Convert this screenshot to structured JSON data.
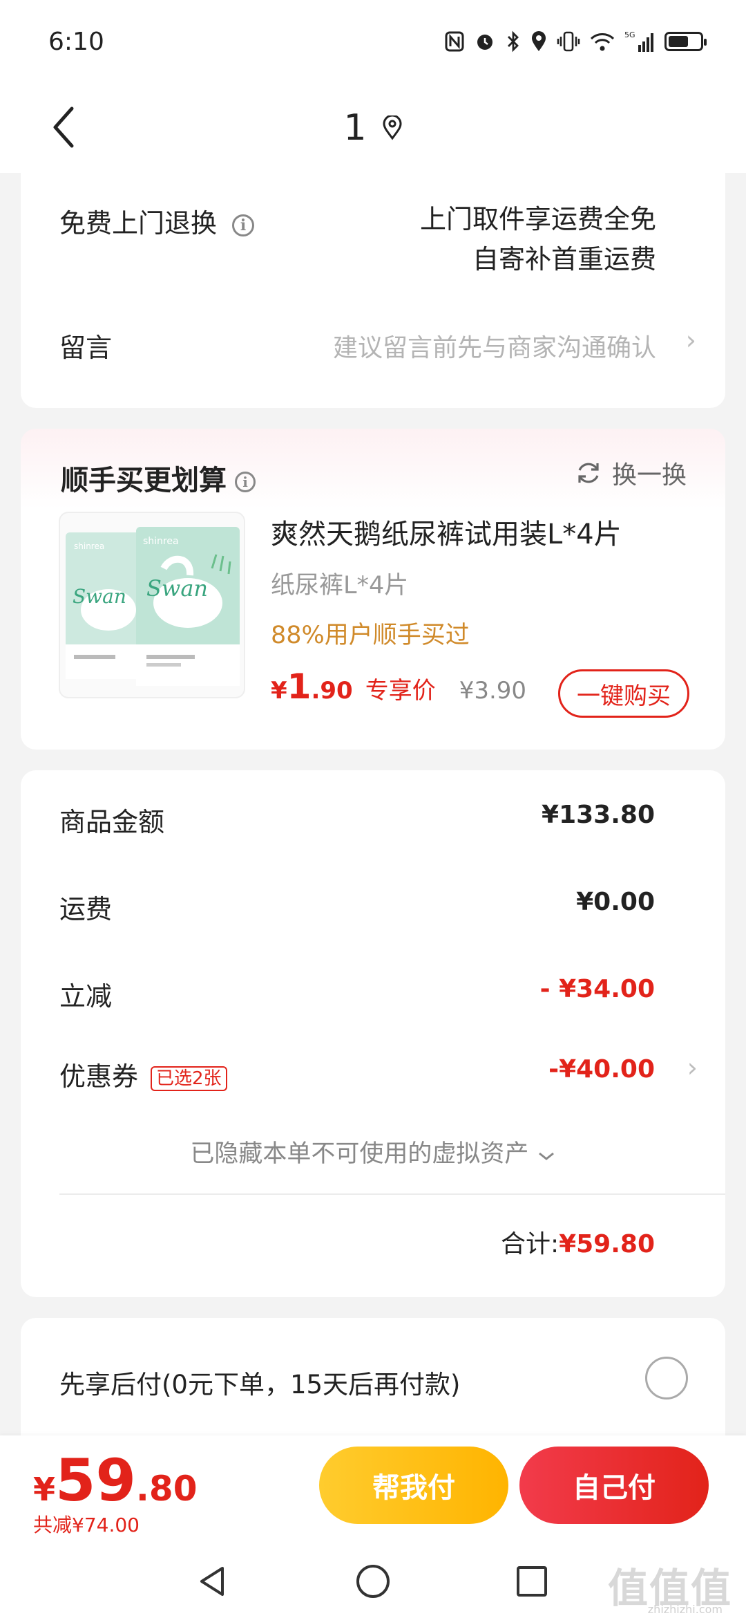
{
  "status_bar": {
    "time": "6:10",
    "network": "5G"
  },
  "nav": {
    "title": "1"
  },
  "return_service": {
    "label": "免费上门退换",
    "line1": "上门取件享运费全免",
    "line2": "自寄补首重运费"
  },
  "message": {
    "label": "留言",
    "placeholder": "建议留言前先与商家沟通确认"
  },
  "upsell": {
    "title": "顺手买更划算",
    "refresh_label": "换一换",
    "product": {
      "name": "爽然天鹅纸尿裤试用装L*4片",
      "spec": "纸尿裤L*4片",
      "social_proof": "88%用户顺手买过",
      "price_symbol": "¥",
      "price_int": "1",
      "price_dec": ".90",
      "price_tag": "专享价",
      "original_price": "¥3.90",
      "buy_label": "一键购买",
      "package_brand": "shinrea",
      "package_text": "Swan"
    }
  },
  "summary": {
    "goods_label": "商品金额",
    "goods_value": "¥133.80",
    "shipping_label": "运费",
    "shipping_value": "¥0.00",
    "discount_label": "立减",
    "discount_value": "- ¥34.00",
    "coupon_label": "优惠券",
    "coupon_badge": "已选2张",
    "coupon_value": "-¥40.00",
    "hidden_assets": "已隐藏本单不可使用的虚拟资产",
    "total_label": "合计:",
    "total_value": "¥59.80"
  },
  "pay_later": {
    "label": "先享后付(0元下单，15天后再付款)"
  },
  "bottom": {
    "symbol": "¥",
    "price_int": "59",
    "price_dec": ".80",
    "saved": "共减¥74.00",
    "help_pay": "帮我付",
    "self_pay": "自己付"
  },
  "watermark": {
    "text": "值值值",
    "sub": "zhizhizhi.com"
  },
  "colors": {
    "accent_red": "#e2231a",
    "accent_yellow": "#ffc21a",
    "social_orange": "#d08a2a"
  }
}
